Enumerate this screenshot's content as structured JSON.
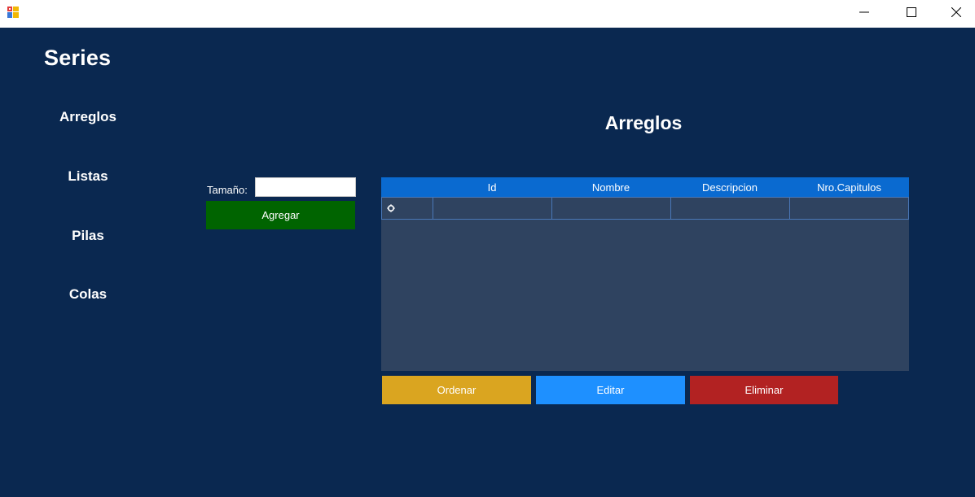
{
  "window": {
    "icon": "app-icon",
    "controls": {
      "minimize_icon": "minimize-icon",
      "maximize_icon": "maximize-icon",
      "close_icon": "close-icon"
    }
  },
  "app": {
    "title": "Series"
  },
  "sidebar": {
    "items": [
      {
        "label": "Arreglos"
      },
      {
        "label": "Listas"
      },
      {
        "label": "Pilas"
      },
      {
        "label": "Colas"
      }
    ]
  },
  "main": {
    "title": "Arreglos",
    "size_form": {
      "label": "Tamaño:",
      "value": "",
      "add_label": "Agregar"
    },
    "table": {
      "columns": [
        "Id",
        "Nombre",
        "Descripcion",
        "Nro.Capitulos"
      ],
      "rows": [
        {
          "marker_icon": "new-row-icon",
          "cells": [
            "",
            "",
            "",
            ""
          ]
        }
      ]
    },
    "actions": {
      "order_label": "Ordenar",
      "edit_label": "Editar",
      "delete_label": "Eliminar"
    }
  },
  "colors": {
    "background": "#0a2850",
    "header": "#0a6ad0",
    "grid_body": "#2f4360",
    "add": "#006400",
    "order": "#daa520",
    "edit": "#1e90ff",
    "delete": "#b22222"
  }
}
